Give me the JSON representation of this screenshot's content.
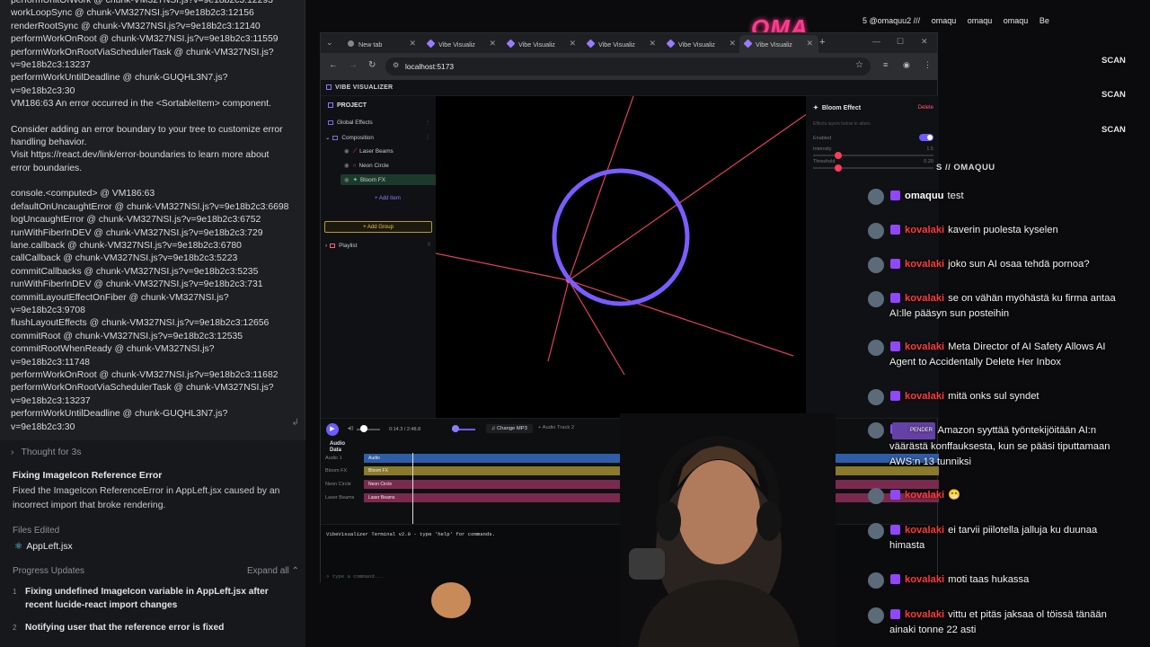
{
  "console": {
    "lines": [
      "performUnitOfWork @ chunk-VM327NSI.js?v=9e18b2c3:12293",
      "workLoopSync @ chunk-VM327NSI.js?v=9e18b2c3:12156",
      "renderRootSync @ chunk-VM327NSI.js?v=9e18b2c3:12140",
      "performWorkOnRoot @ chunk-VM327NSI.js?v=9e18b2c3:11559",
      "performWorkOnRootViaSchedulerTask @ chunk-VM327NSI.js?",
      "v=9e18b2c3:13237",
      "performWorkUntilDeadline @ chunk-GUQHL3N7.js?",
      "v=9e18b2c3:30",
      "VM186:63 An error occurred in the <SortableItem> component.",
      "",
      "Consider adding an error boundary to your tree to customize error",
      "handling behavior.",
      "Visit https://react.dev/link/error-boundaries to learn more about",
      "error boundaries.",
      "",
      "console.<computed> @ VM186:63",
      "defaultOnUncaughtError @ chunk-VM327NSI.js?v=9e18b2c3:6698",
      "logUncaughtError @ chunk-VM327NSI.js?v=9e18b2c3:6752",
      "runWithFiberInDEV @ chunk-VM327NSI.js?v=9e18b2c3:729",
      "lane.callback @ chunk-VM327NSI.js?v=9e18b2c3:6780",
      "callCallback @ chunk-VM327NSI.js?v=9e18b2c3:5223",
      "commitCallbacks @ chunk-VM327NSI.js?v=9e18b2c3:5235",
      "runWithFiberInDEV @ chunk-VM327NSI.js?v=9e18b2c3:731",
      "commitLayoutEffectOnFiber @ chunk-VM327NSI.js?",
      "v=9e18b2c3:9708",
      "flushLayoutEffects @ chunk-VM327NSI.js?v=9e18b2c3:12656",
      "commitRoot @ chunk-VM327NSI.js?v=9e18b2c3:12535",
      "commitRootWhenReady @ chunk-VM327NSI.js?",
      "v=9e18b2c3:11748",
      "performWorkOnRoot @ chunk-VM327NSI.js?v=9e18b2c3:11682",
      "performWorkOnRootViaSchedulerTask @ chunk-VM327NSI.js?",
      "v=9e18b2c3:13237",
      "performWorkUntilDeadline @ chunk-GUQHL3N7.js?",
      "v=9e18b2c3:30"
    ]
  },
  "agent": {
    "thought": "Thought for 3s",
    "fix_title": "Fixing ImageIcon Reference Error",
    "fix_desc": "Fixed the ImageIcon ReferenceError in AppLeft.jsx caused by an incorrect import that broke rendering.",
    "files_label": "Files Edited",
    "file": "AppLeft.jsx",
    "progress_label": "Progress Updates",
    "expand_all": "Expand all",
    "progress": [
      {
        "num": "1",
        "text": "Fixing undefined ImageIcon variable in AppLeft.jsx after recent lucide-react import changes"
      },
      {
        "num": "2",
        "text": "Notifying user that the reference error is fixed"
      }
    ]
  },
  "browser": {
    "tabs": [
      {
        "label": "New tab",
        "fav": "#888888"
      },
      {
        "label": "Vibe Visualiz",
        "fav": "#9b7bff"
      },
      {
        "label": "Vibe Visualiz",
        "fav": "#9b7bff"
      },
      {
        "label": "Vibe Visualiz",
        "fav": "#9b7bff"
      },
      {
        "label": "Vibe Visualiz",
        "fav": "#9b7bff"
      },
      {
        "label": "Vibe Visualiz",
        "fav": "#9b7bff"
      }
    ],
    "url": "localhost:5173"
  },
  "app": {
    "title": "VIBE VISUALIZER",
    "project_header": "PROJECT",
    "tree": {
      "global_effects": "Global Effects",
      "composition": "Composition",
      "laser_beams": "Laser Beams",
      "neon_circle": "Neon Circle",
      "bloom_fx": "Bloom FX",
      "add_item": "+ Add Item",
      "add_group": "Add Group",
      "playlist": "Playlist"
    },
    "props": {
      "title": "Bloom Effect",
      "delete": "Delete",
      "hint": "Effects layers below to alters",
      "enabled": "Enabled",
      "intensity": "Intensity",
      "intensity_val": "1.5",
      "threshold": "Threshold",
      "threshold_val": "0.20"
    },
    "transport": {
      "time": "0:14.3 / 2:48.8",
      "change_mp3": "Change MP3",
      "audio_track": "+ Audio Track 2"
    },
    "timeline": {
      "audio_head_1": "Audio",
      "audio_head_2": "Data",
      "tracks": [
        {
          "label": "Audio 1",
          "clip": "Audio",
          "color": "#2f5ea8"
        },
        {
          "label": "Bloom FX",
          "clip": "Bloom FX",
          "color": "#8a7a2a"
        },
        {
          "label": "Neon Circle",
          "clip": "Neon Circle",
          "color": "#7a2a4e"
        },
        {
          "label": "Laser Beams",
          "clip": "Laser Beams",
          "color": "#7a2a4e"
        }
      ]
    },
    "terminal": {
      "line": "VibeVisualizer Terminal v2.0 - type 'help' for commands.",
      "prompt": "> type a command..."
    }
  },
  "stream": {
    "topbar": [
      "5 @omaquu2 ///",
      "omaqu",
      "omaqu",
      "omaqu",
      "Be"
    ],
    "scan": "SCAN",
    "chat_header": "S // OMAQUU",
    "messages": [
      {
        "user": "omaquu",
        "color": "#ffffff",
        "text": "test",
        "pending": ""
      },
      {
        "user": "kovalaki",
        "color": "#ff3b3b",
        "text": "kaverin puolesta kyselen",
        "pending": ""
      },
      {
        "user": "kovalaki",
        "color": "#ff3b3b",
        "text": "joko sun AI osaa tehdä pornoa?",
        "pending": ""
      },
      {
        "user": "kovalaki",
        "color": "#ff3b3b",
        "text": "se on vähän myöhästä ku firma antaa AI:lle pääsyn sun posteihin",
        "pending": ""
      },
      {
        "user": "kovalaki",
        "color": "#ff3b3b",
        "text": "Meta Director of AI Safety Allows AI Agent to Accidentally Delete Her Inbox",
        "pending": ""
      },
      {
        "user": "kovalaki",
        "color": "#ff3b3b",
        "text": "mitä onks sul syndet",
        "pending": ""
      },
      {
        "user": "",
        "color": "#ff3b3b",
        "text": "Amazon syyttää työntekijöitään AI:n väärästä konffauksesta, kun se pääsi tiputtamaan AWS:n 13 tunniksi",
        "pending": "PENDER"
      },
      {
        "user": "kovalaki",
        "color": "#ff3b3b",
        "text": "😁",
        "pending": ""
      },
      {
        "user": "kovalaki",
        "color": "#ff3b3b",
        "text": "ei tarvii piilotella jalluja ku duunaa himasta",
        "pending": ""
      },
      {
        "user": "kovalaki",
        "color": "#ff3b3b",
        "text": "moti taas hukassa",
        "pending": ""
      },
      {
        "user": "kovalaki",
        "color": "#ff3b3b",
        "text": "vittu et pitäs jaksaa ol töissä tänään ainaki tonne 22 asti",
        "pending": ""
      }
    ]
  }
}
